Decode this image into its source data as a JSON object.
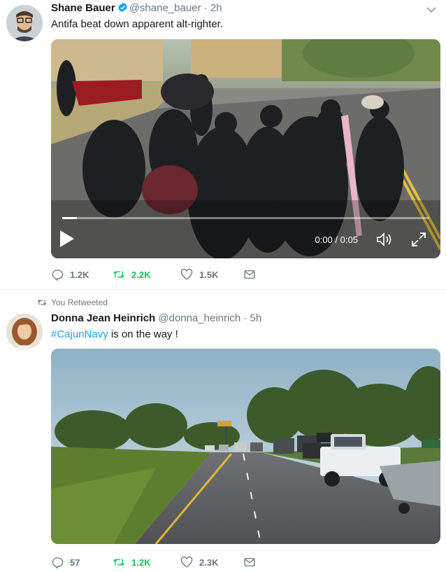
{
  "tweets": [
    {
      "name": "Shane Bauer",
      "handle": "@shane_bauer",
      "separator": "·",
      "time": "2h",
      "text": "Antifa beat down apparent alt-righter.",
      "media": {
        "kind": "video",
        "time_display": "0:00 / 0:05",
        "progress": 0.04
      },
      "actions": {
        "replies": "1.2K",
        "retweets": "2.2K",
        "likes": "1.5K"
      }
    },
    {
      "retweet_label": "You Retweeted",
      "name": "Donna Jean Heinrich",
      "handle": "@donna_heinrich",
      "separator": "·",
      "time": "5h",
      "hashtag": "#CajunNavy",
      "text_rest": " is on the way !",
      "media": {
        "kind": "photo"
      },
      "actions": {
        "replies": "57",
        "retweets": "1.2K",
        "likes": "2.3K"
      }
    }
  ],
  "colors": {
    "link": "#1da1f2",
    "retweet_active": "#17bf63",
    "secondary_text": "#657786",
    "divider": "#e6ecf0"
  },
  "icons": [
    "verified-badge-icon",
    "chevron-down-icon",
    "reply-icon",
    "retweet-icon",
    "like-icon",
    "message-icon",
    "play-icon",
    "volume-icon",
    "fullscreen-icon"
  ]
}
